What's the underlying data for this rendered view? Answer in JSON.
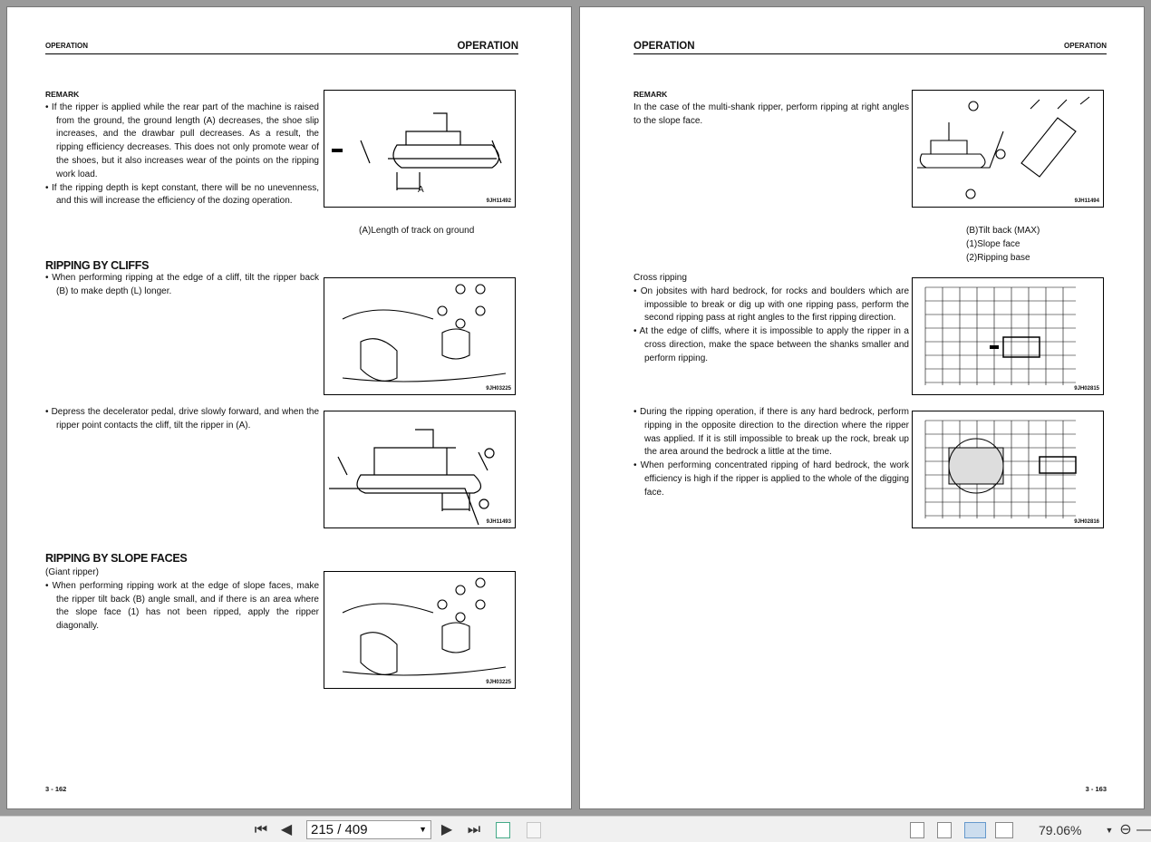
{
  "left_page": {
    "header_small": "OPERATION",
    "header_big": "OPERATION",
    "remark_label": "REMARK",
    "remark_bullets": [
      "If the ripper is applied while the rear part of the machine is raised from the ground, the ground length (A) decreases, the shoe slip increases, and the drawbar pull decreases. As a result, the ripping efficiency decreases. This does not only promote wear of the shoes, but it also increases wear of the points on the ripping work load.",
      "If the ripping depth is kept constant, there will be no unevenness, and this will increase the efficiency of the dozing operation."
    ],
    "fig1_code": "9JH11492",
    "fig1_label_a": "A",
    "fig1_caption": "(A)Length of track on ground",
    "section1_title": "RIPPING BY CLIFFS",
    "section1_bullet1": "When performing ripping at the edge of a cliff, tilt the ripper back (B) to make depth (L) longer.",
    "fig2_code": "9JH03225",
    "section1_bullet2": "Depress the decelerator pedal, drive slowly forward, and when the ripper point contacts the cliff, tilt the ripper in (A).",
    "fig3_code": "9JH11493",
    "section2_title": "RIPPING BY SLOPE FACES",
    "section2_sub": "(Giant ripper)",
    "section2_bullet": "When performing ripping work at the edge of slope faces, make the ripper tilt back (B) angle small, and if there is an area where the slope face (1) has not been ripped, apply the ripper diagonally.",
    "fig4_code": "9JH03225",
    "page_number": "3 - 162"
  },
  "right_page": {
    "header_big": "OPERATION",
    "header_small": "OPERATION",
    "remark_label": "REMARK",
    "remark_text": "In the case of the multi-shank ripper, perform ripping at right angles to the slope face.",
    "fig1_code": "9JH11494",
    "fig1_captions": [
      "(B)Tilt back (MAX)",
      "(1)Slope face",
      "(2)Ripping base"
    ],
    "cross_title": "Cross ripping",
    "cross_bullets": [
      "On jobsites with hard bedrock, for rocks and boulders which are impossible to break or dig up with one ripping pass, perform the second ripping pass at right angles to the first ripping direction.",
      "At the edge of cliffs, where it is impossible to apply the ripper in a cross direction, make the space between the shanks smaller and perform ripping."
    ],
    "fig2_code": "9JH02815",
    "bedrock_bullets": [
      "During the ripping operation, if there is any hard bedrock, perform ripping in the opposite direction to the direction where the ripper was applied.  If it is still impossible to break up the rock, break up the area around the bedrock a little at the time.",
      "When performing concentrated ripping of hard bedrock, the work efficiency is high if the ripper is applied to the whole of the digging face."
    ],
    "fig3_code": "9JH02816",
    "page_number": "3 - 163"
  },
  "toolbar": {
    "first_icon": "first-page-icon",
    "prev_icon": "previous-page-icon",
    "page_value": "215 / 409",
    "next_icon": "next-page-icon",
    "last_icon": "last-page-icon",
    "zoom_value": "79.06%",
    "active_view": "two-page"
  }
}
